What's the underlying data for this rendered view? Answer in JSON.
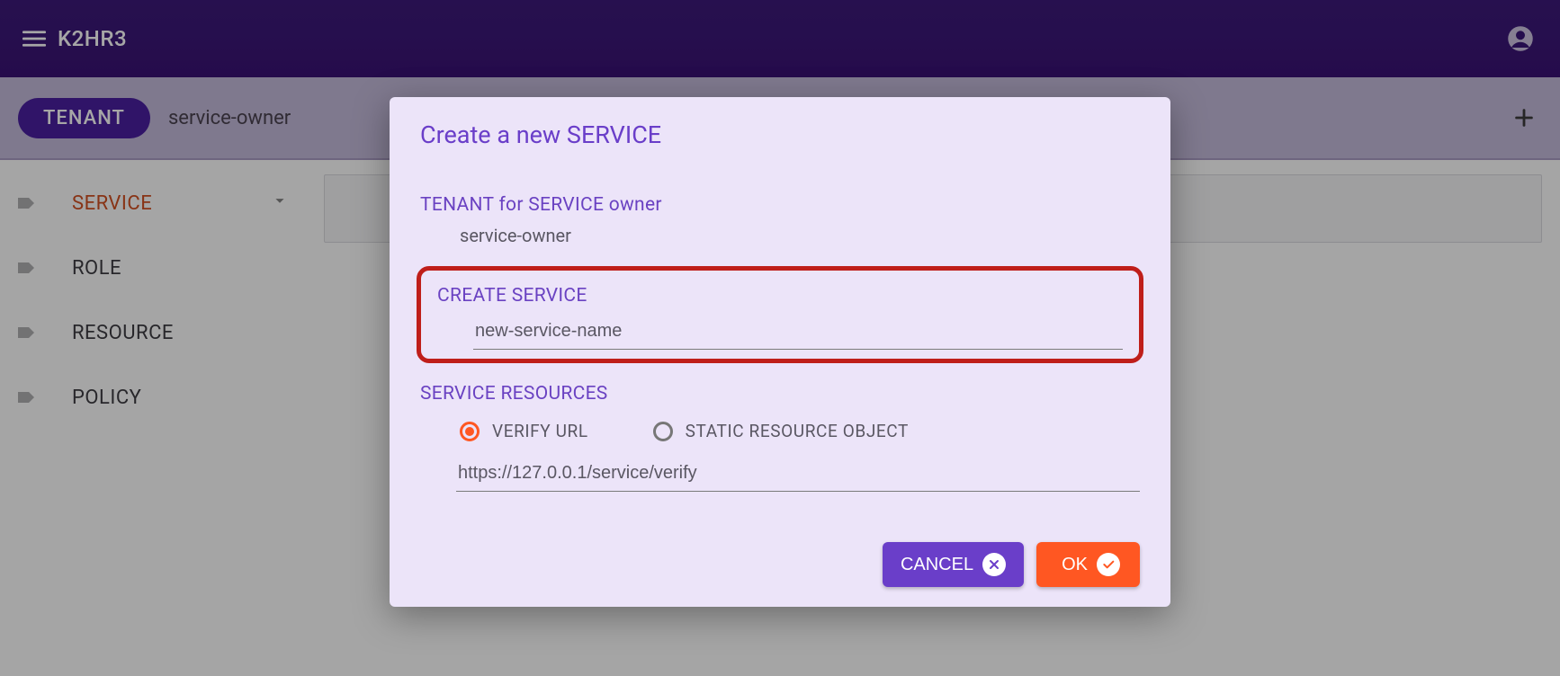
{
  "header": {
    "app_title": "K2HR3"
  },
  "tenant_bar": {
    "chip_label": "TENANT",
    "tenant_name": "service-owner"
  },
  "sidebar": {
    "items": [
      {
        "label": "SERVICE",
        "active": true,
        "expandable": true
      },
      {
        "label": "ROLE",
        "active": false,
        "expandable": false
      },
      {
        "label": "RESOURCE",
        "active": false,
        "expandable": false
      },
      {
        "label": "POLICY",
        "active": false,
        "expandable": false
      }
    ]
  },
  "dialog": {
    "title": "Create a new SERVICE",
    "tenant_section_label": "TENANT for SERVICE owner",
    "tenant_value": "service-owner",
    "create_section_label": "CREATE SERVICE",
    "service_name_value": "new-service-name",
    "resources_section_label": "SERVICE RESOURCES",
    "radio_verify_label": "VERIFY URL",
    "radio_static_label": "STATIC RESOURCE OBJECT",
    "resource_url_value": "https://127.0.0.1/service/verify",
    "cancel_label": "CANCEL",
    "ok_label": "OK"
  }
}
